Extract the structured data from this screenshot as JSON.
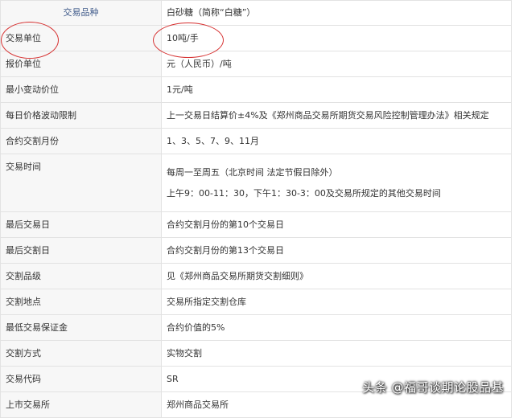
{
  "table": {
    "header": {
      "label": "交易品种",
      "value": "白砂糖（简称“白糖”）"
    },
    "rows": [
      {
        "label": "交易单位",
        "value": "10吨/手"
      },
      {
        "label": "报价单位",
        "value": "元（人民币）/吨"
      },
      {
        "label": "最小变动价位",
        "value": "1元/吨"
      },
      {
        "label": "每日价格波动限制",
        "value": "上一交易日结算价±4%及《郑州商品交易所期货交易风险控制管理办法》相关规定"
      },
      {
        "label": "合约交割月份",
        "value": "1、3、5、7、9、11月"
      },
      {
        "label": "交易时间",
        "value_lines": [
          "每周一至周五（北京时间 法定节假日除外）",
          "上午9：00-11：30，下午1：30-3：00及交易所规定的其他交易时间"
        ]
      },
      {
        "label": "最后交易日",
        "value": "合约交割月份的第10个交易日"
      },
      {
        "label": "最后交割日",
        "value": "合约交割月份的第13个交易日"
      },
      {
        "label": "交割品级",
        "value": "见《郑州商品交易所期货交割细则》"
      },
      {
        "label": "交割地点",
        "value": "交易所指定交割仓库"
      },
      {
        "label": "最低交易保证金",
        "value": "合约价值的5%"
      },
      {
        "label": "交割方式",
        "value": "实物交割"
      },
      {
        "label": "交易代码",
        "value": "SR"
      },
      {
        "label": "上市交易所",
        "value": "郑州商品交易所"
      }
    ]
  },
  "watermark": "头条 @福哥谈期论股品基",
  "colors": {
    "header_text": "#3f5a8a",
    "highlight_ring": "#d63030",
    "border": "#e2e2e2"
  }
}
